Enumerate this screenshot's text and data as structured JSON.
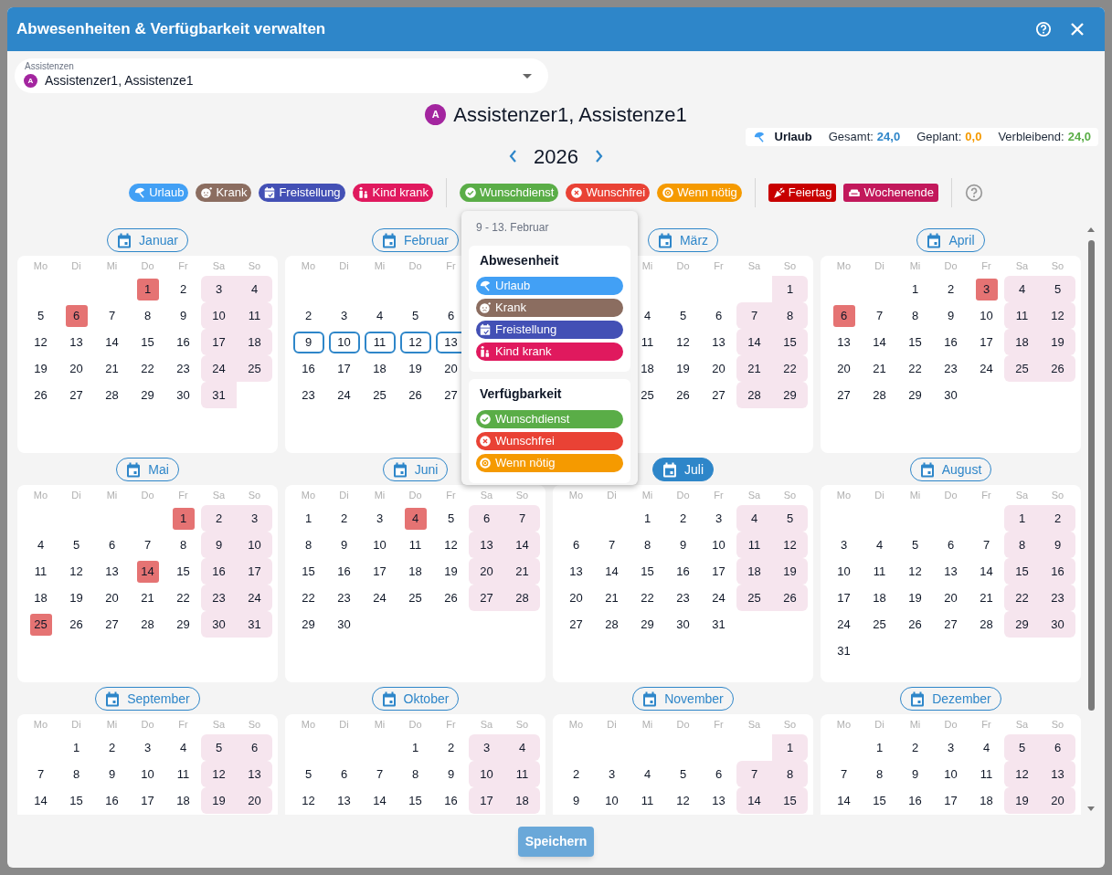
{
  "window": {
    "title": "Abwesenheiten & Verfügbarkeit verwalten"
  },
  "selector": {
    "label": "Assistenzen",
    "avatar": "A",
    "value": "Assistenzer1, Assistenze1"
  },
  "person": {
    "avatar": "A",
    "name": "Assistenzer1, Assistenze1"
  },
  "summary": {
    "label": "Urlaub",
    "items": [
      {
        "label": "Gesamt:",
        "value": "24,0",
        "color": "#2f86c9"
      },
      {
        "label": "Geplant:",
        "value": "0,0",
        "color": "#f59a00"
      },
      {
        "label": "Verbleibend:",
        "value": "24,0",
        "color": "#5aad47"
      }
    ]
  },
  "year": "2026",
  "legend": [
    {
      "kind": "absence",
      "items": [
        {
          "label": "Urlaub",
          "color": "#42a0f5"
        },
        {
          "label": "Krank",
          "color": "#8b6d60"
        },
        {
          "label": "Freistellung",
          "color": "#4350b5"
        },
        {
          "label": "Kind krank",
          "color": "#e0195e"
        }
      ]
    },
    {
      "kind": "availability",
      "items": [
        {
          "label": "Wunschdienst",
          "color": "#5aad47"
        },
        {
          "label": "Wunschfrei",
          "color": "#e94235"
        },
        {
          "label": "Wenn nötig",
          "color": "#f59a00"
        }
      ]
    },
    {
      "kind": "marker",
      "items": [
        {
          "label": "Feiertag",
          "color": "#c80000"
        },
        {
          "label": "Wochenende",
          "color": "#c2185b"
        }
      ]
    }
  ],
  "months": [
    {
      "name": "Januar",
      "selected": false,
      "weekdays": {
        "mo": "Mo",
        "di": "Di",
        "mi": "Mi",
        "do": "Do",
        "fr": "Fr",
        "sa": "Sa",
        "so": "So"
      },
      "weeks": [
        {
          "do": {
            "day": "1",
            "holiday": true
          },
          "fr": "2",
          "sa": "3",
          "so": "4"
        },
        {
          "mo": "5",
          "di": {
            "day": "6",
            "holiday": true
          },
          "mi": "7",
          "do": "8",
          "fr": "9",
          "sa": "10",
          "so": "11"
        },
        {
          "mo": "12",
          "di": "13",
          "mi": "14",
          "do": "15",
          "fr": "16",
          "sa": "17",
          "so": "18"
        },
        {
          "mo": "19",
          "di": "20",
          "mi": "21",
          "do": "22",
          "fr": "23",
          "sa": "24",
          "so": "25"
        },
        {
          "mo": "26",
          "di": "27",
          "mi": "28",
          "do": "29",
          "fr": "30",
          "sa": "31"
        }
      ]
    },
    {
      "name": "Februar",
      "selected": false,
      "top_row_covered": true,
      "weekdays": {
        "mo": "Mo",
        "di": "Di",
        "mi": "Mi",
        "do": "Do",
        "fr": "Fr"
      },
      "weeks": [
        {
          "mo": "2",
          "di": "3",
          "mi": "4",
          "do": "5",
          "fr": "6"
        },
        {
          "mo": {
            "day": "9",
            "in_range": true
          },
          "di": {
            "day": "10",
            "in_range": true
          },
          "mi": {
            "day": "11",
            "in_range": true
          },
          "do": {
            "day": "12",
            "in_range": true
          },
          "fr": {
            "day": "13",
            "in_range": true
          }
        },
        {
          "mo": "16",
          "di": "17",
          "mi": "18",
          "do": "19",
          "fr": "20"
        },
        {
          "mo": "23",
          "di": "24",
          "mi": "25",
          "do": "26",
          "fr": "27"
        }
      ]
    },
    {
      "name": "März",
      "selected": false,
      "weekdays": {
        "mi": "Mi",
        "do": "Do",
        "fr": "Fr",
        "sa": "Sa",
        "so": "So"
      },
      "weeks": [
        {
          "so": "1"
        },
        {
          "mi": "4",
          "do": "5",
          "fr": "6",
          "sa": "7",
          "so": "8"
        },
        {
          "mi": "11",
          "do": "12",
          "fr": "13",
          "sa": "14",
          "so": "15"
        },
        {
          "mi": "18",
          "do": "19",
          "fr": "20",
          "sa": "21",
          "so": "22"
        },
        {
          "mi": "25",
          "do": "26",
          "fr": "27",
          "sa": "28",
          "so": "29"
        }
      ]
    },
    {
      "name": "April",
      "selected": false,
      "weekdays": {
        "mo": "Mo",
        "di": "Di",
        "mi": "Mi",
        "do": "Do",
        "fr": "Fr",
        "sa": "Sa",
        "so": "So"
      },
      "weeks": [
        {
          "mi": "1",
          "do": "2",
          "fr": {
            "day": "3",
            "holiday": true
          },
          "sa": "4",
          "so": "5"
        },
        {
          "mo": {
            "day": "6",
            "holiday": true
          },
          "di": "7",
          "mi": "8",
          "do": "9",
          "fr": "10",
          "sa": "11",
          "so": "12"
        },
        {
          "mo": "13",
          "di": "14",
          "mi": "15",
          "do": "16",
          "fr": "17",
          "sa": "18",
          "so": "19"
        },
        {
          "mo": "20",
          "di": "21",
          "mi": "22",
          "do": "23",
          "fr": "24",
          "sa": "25",
          "so": "26"
        },
        {
          "mo": "27",
          "di": "28",
          "mi": "29",
          "do": "30"
        }
      ]
    },
    {
      "name": "Mai",
      "selected": false,
      "weekdays": {
        "mo": "Mo",
        "di": "Di",
        "mi": "Mi",
        "do": "Do",
        "fr": "Fr",
        "sa": "Sa",
        "so": "So"
      },
      "weeks": [
        {
          "fr": {
            "day": "1",
            "holiday": true
          },
          "sa": "2",
          "so": "3"
        },
        {
          "mo": "4",
          "di": "5",
          "mi": "6",
          "do": "7",
          "fr": "8",
          "sa": "9",
          "so": "10"
        },
        {
          "mo": "11",
          "di": "12",
          "mi": "13",
          "do": {
            "day": "14",
            "holiday": true
          },
          "fr": "15",
          "sa": "16",
          "so": "17"
        },
        {
          "mo": "18",
          "di": "19",
          "mi": "20",
          "do": "21",
          "fr": "22",
          "sa": "23",
          "so": "24"
        },
        {
          "mo": {
            "day": "25",
            "holiday": true
          },
          "di": "26",
          "mi": "27",
          "do": "28",
          "fr": "29",
          "sa": "30",
          "so": "31"
        }
      ]
    },
    {
      "name": "Juni",
      "selected": false,
      "weekdays": {
        "mo": "Mo",
        "di": "Di",
        "mi": "Mi",
        "do": "Do",
        "fr": "Fr",
        "sa": "Sa",
        "so": "So"
      },
      "weeks": [
        {
          "mo": "1",
          "di": "2",
          "mi": "3",
          "do": {
            "day": "4",
            "holiday": true
          },
          "fr": "5",
          "sa": "6",
          "so": "7"
        },
        {
          "mo": "8",
          "di": "9",
          "mi": "10",
          "do": "11",
          "fr": "12",
          "sa": "13",
          "so": "14"
        },
        {
          "mo": "15",
          "di": "16",
          "mi": "17",
          "do": "18",
          "fr": "19",
          "sa": "20",
          "so": "21"
        },
        {
          "mo": "22",
          "di": "23",
          "mi": "24",
          "do": "25",
          "fr": "26",
          "sa": "27",
          "so": "28"
        },
        {
          "mo": "29",
          "di": "30"
        }
      ]
    },
    {
      "name": "Juli",
      "selected": true,
      "weekdays": {
        "mo": "Mo",
        "di": "Di",
        "mi": "Mi",
        "do": "Do",
        "fr": "Fr",
        "sa": "Sa",
        "so": "So"
      },
      "weeks": [
        {
          "mi": "1",
          "do": "2",
          "fr": "3",
          "sa": "4",
          "so": "5"
        },
        {
          "mo": "6",
          "di": "7",
          "mi": "8",
          "do": "9",
          "fr": "10",
          "sa": "11",
          "so": "12"
        },
        {
          "mo": "13",
          "di": "14",
          "mi": "15",
          "do": "16",
          "fr": "17",
          "sa": "18",
          "so": "19"
        },
        {
          "mo": "20",
          "di": "21",
          "mi": "22",
          "do": "23",
          "fr": "24",
          "sa": "25",
          "so": "26"
        },
        {
          "mo": "27",
          "di": "28",
          "mi": "29",
          "do": "30",
          "fr": "31"
        }
      ]
    },
    {
      "name": "August",
      "selected": false,
      "weekdays": {
        "mo": "Mo",
        "di": "Di",
        "mi": "Mi",
        "do": "Do",
        "fr": "Fr",
        "sa": "Sa",
        "so": "So"
      },
      "weeks": [
        {
          "sa": "1",
          "so": "2"
        },
        {
          "mo": "3",
          "di": "4",
          "mi": "5",
          "do": "6",
          "fr": "7",
          "sa": "8",
          "so": "9"
        },
        {
          "mo": "10",
          "di": "11",
          "mi": "12",
          "do": "13",
          "fr": "14",
          "sa": "15",
          "so": "16"
        },
        {
          "mo": "17",
          "di": "18",
          "mi": "19",
          "do": "20",
          "fr": "21",
          "sa": "22",
          "so": "23"
        },
        {
          "mo": "24",
          "di": "25",
          "mi": "26",
          "do": "27",
          "fr": "28",
          "sa": "29",
          "so": "30"
        },
        {
          "mo": "31"
        }
      ]
    },
    {
      "name": "September",
      "selected": false,
      "weekdays": {
        "mo": "Mo",
        "di": "Di",
        "mi": "Mi",
        "do": "Do",
        "fr": "Fr",
        "sa": "Sa",
        "so": "So"
      },
      "weeks": [
        {
          "di": "1",
          "mi": "2",
          "do": "3",
          "fr": "4",
          "sa": "5",
          "so": "6"
        },
        {
          "mo": "7",
          "di": "8",
          "mi": "9",
          "do": "10",
          "fr": "11",
          "sa": "12",
          "so": "13"
        },
        {
          "mo": "14",
          "di": "15",
          "mi": "16",
          "do": "17",
          "fr": "18",
          "sa": "19",
          "so": "20"
        }
      ]
    },
    {
      "name": "Oktober",
      "selected": false,
      "weekdays": {
        "mo": "Mo",
        "di": "Di",
        "mi": "Mi",
        "do": "Do",
        "fr": "Fr",
        "sa": "Sa",
        "so": "So"
      },
      "weeks": [
        {
          "do": "1",
          "fr": "2",
          "sa": "3",
          "so": "4"
        },
        {
          "mo": "5",
          "di": "6",
          "mi": "7",
          "do": "8",
          "fr": "9",
          "sa": "10",
          "so": "11"
        },
        {
          "mo": "12",
          "di": "13",
          "mi": "14",
          "do": "15",
          "fr": "16",
          "sa": "17",
          "so": "18"
        }
      ]
    },
    {
      "name": "November",
      "selected": false,
      "weekdays": {
        "mo": "Mo",
        "di": "Di",
        "mi": "Mi",
        "do": "Do",
        "fr": "Fr",
        "sa": "Sa",
        "so": "So"
      },
      "weeks": [
        {
          "so": "1"
        },
        {
          "mo": "2",
          "di": "3",
          "mi": "4",
          "do": "5",
          "fr": "6",
          "sa": "7",
          "so": "8"
        },
        {
          "mo": "9",
          "di": "10",
          "mi": "11",
          "do": "12",
          "fr": "13",
          "sa": "14",
          "so": "15"
        }
      ]
    },
    {
      "name": "Dezember",
      "selected": false,
      "weekdays": {
        "mo": "Mo",
        "di": "Di",
        "mi": "Mi",
        "do": "Do",
        "fr": "Fr",
        "sa": "Sa",
        "so": "So"
      },
      "weeks": [
        {
          "di": "1",
          "mi": "2",
          "do": "3",
          "fr": "4",
          "sa": "5",
          "so": "6"
        },
        {
          "mo": "7",
          "di": "8",
          "mi": "9",
          "do": "10",
          "fr": "11",
          "sa": "12",
          "so": "13"
        },
        {
          "mo": "14",
          "di": "15",
          "mi": "16",
          "do": "17",
          "fr": "18",
          "sa": "19",
          "so": "20"
        }
      ]
    }
  ],
  "popup": {
    "title": "9 - 13. Februar",
    "sections": [
      {
        "kind": "absence",
        "heading": "Abwesenheit",
        "items": [
          {
            "label": "Urlaub",
            "color": "#42a0f5"
          },
          {
            "label": "Krank",
            "color": "#8b6d60"
          },
          {
            "label": "Freistellung",
            "color": "#4350b5"
          },
          {
            "label": "Kind krank",
            "color": "#e0195e"
          }
        ]
      },
      {
        "kind": "availability",
        "heading": "Verfügbarkeit",
        "items": [
          {
            "label": "Wunschdienst",
            "color": "#5aad47"
          },
          {
            "label": "Wunschfrei",
            "color": "#e94235"
          },
          {
            "label": "Wenn nötig",
            "color": "#f59a00"
          }
        ]
      }
    ]
  },
  "footer": {
    "button": "Speichern"
  }
}
